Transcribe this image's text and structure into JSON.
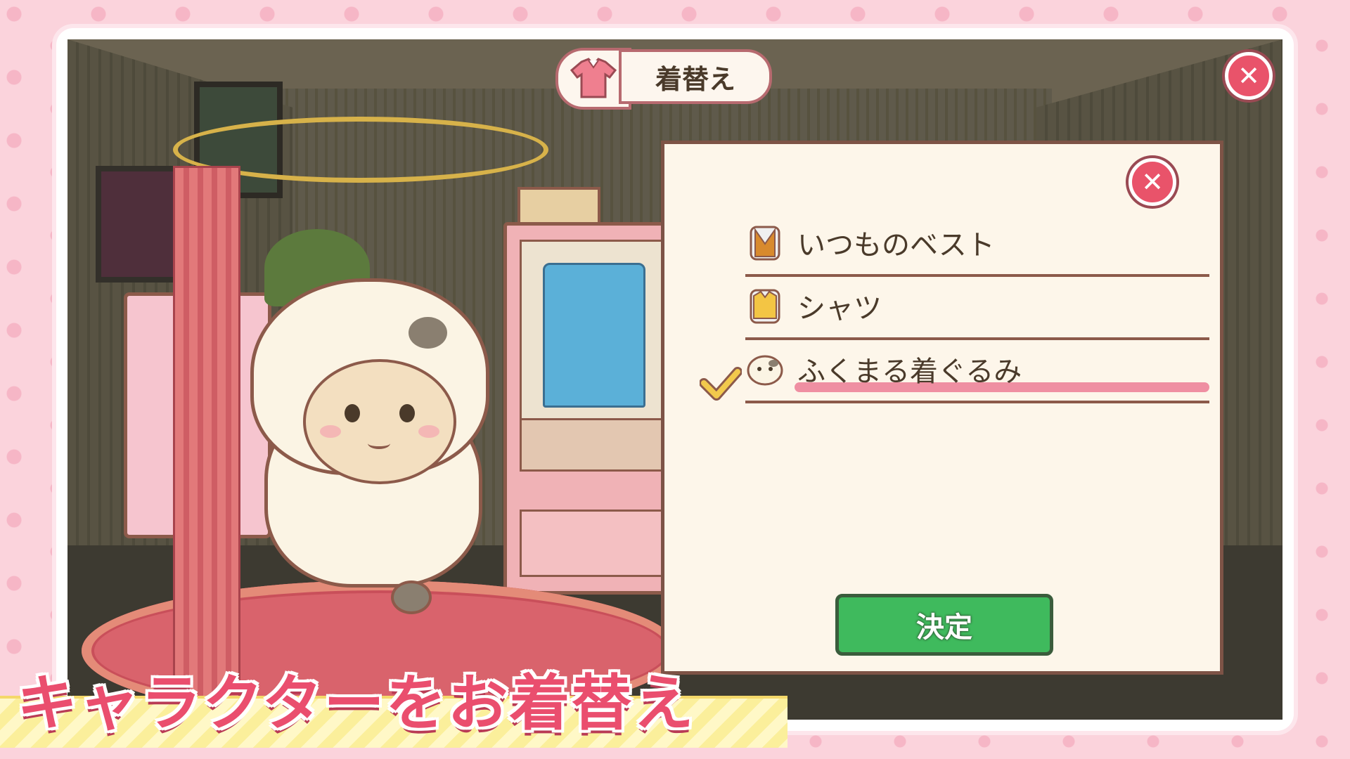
{
  "screen": {
    "title": "着替え",
    "title_icon": "shirt-icon",
    "close_icon": "close-icon"
  },
  "dialog": {
    "close_icon": "close-icon",
    "options": [
      {
        "label": "いつものベスト",
        "icon": "vest-outfit-icon",
        "selected": false
      },
      {
        "label": "シャツ",
        "icon": "shirt-outfit-icon",
        "selected": false
      },
      {
        "label": "ふくまる着ぐるみ",
        "icon": "cat-costume-icon",
        "selected": true
      }
    ],
    "confirm_label": "決定"
  },
  "caption": {
    "text": "キャラクターをお着替え"
  },
  "colors": {
    "accent_pink": "#ea4e6e",
    "confirm_green": "#3fba5d",
    "panel_cream": "#fdf6ea",
    "border_brown": "#7d5346"
  }
}
